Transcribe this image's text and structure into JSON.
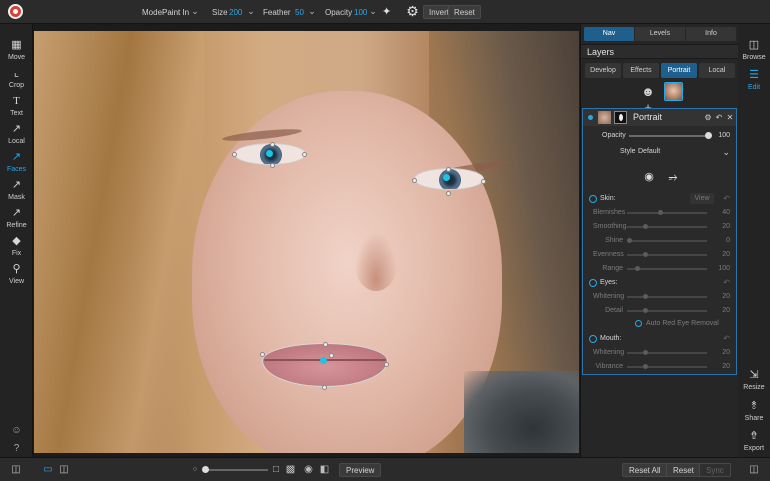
{
  "topbar": {
    "mode_label": "Mode",
    "mode_value": "Paint In",
    "size_label": "Size",
    "size_value": "200",
    "feather_label": "Feather",
    "feather_value": "50",
    "opacity_label": "Opacity",
    "opacity_value": "100",
    "invert_label": "Invert",
    "reset_label": "Reset"
  },
  "leftbar": {
    "tools": [
      {
        "label": "Move",
        "icon": "move-icon"
      },
      {
        "label": "Crop",
        "icon": "crop-icon"
      },
      {
        "label": "Text",
        "icon": "text-icon"
      },
      {
        "label": "Local",
        "icon": "brush-icon"
      },
      {
        "label": "Faces",
        "icon": "faces-brush-icon"
      },
      {
        "label": "Mask",
        "icon": "mask-brush-icon"
      },
      {
        "label": "Refine",
        "icon": "refine-brush-icon"
      },
      {
        "label": "Fix",
        "icon": "eraser-icon"
      },
      {
        "label": "View",
        "icon": "magnifier-icon"
      }
    ],
    "active_tool": "Faces"
  },
  "panel": {
    "top_tabs": [
      "Nav",
      "Levels",
      "Info"
    ],
    "active_top_tab": "Nav",
    "layers_title": "Layers",
    "sub_tabs": [
      "Develop",
      "Effects",
      "Portrait",
      "Local"
    ],
    "active_sub_tab": "Portrait",
    "layer": {
      "name": "Portrait",
      "opacity_label": "Opacity",
      "opacity_value": "100",
      "opacity_level": 1.0,
      "style_label": "Style",
      "style_value": "Default",
      "skin": {
        "title": "Skin:",
        "view_label": "View",
        "sliders": [
          {
            "label": "Blemishes",
            "value": "40",
            "level": 0.4
          },
          {
            "label": "Smoothing",
            "value": "20",
            "level": 0.2
          },
          {
            "label": "Shine",
            "value": "0",
            "level": 0.0
          },
          {
            "label": "Evenness",
            "value": "20",
            "level": 0.2
          },
          {
            "label": "Range",
            "value": "100",
            "level": 0.1
          }
        ]
      },
      "eyes": {
        "title": "Eyes:",
        "sliders": [
          {
            "label": "Whitening",
            "value": "20",
            "level": 0.2
          },
          {
            "label": "Detail",
            "value": "20",
            "level": 0.2
          }
        ],
        "red_eye_label": "Auto Red Eye Removal"
      },
      "mouth": {
        "title": "Mouth:",
        "sliders": [
          {
            "label": "Whitening",
            "value": "20",
            "level": 0.2
          },
          {
            "label": "Vibrance",
            "value": "20",
            "level": 0.2
          }
        ]
      }
    }
  },
  "rightbar": {
    "tools": [
      {
        "label": "Browse",
        "icon": "browse-icon"
      },
      {
        "label": "Edit",
        "icon": "sliders-icon"
      },
      {
        "label": "Resize",
        "icon": "resize-icon"
      },
      {
        "label": "Share",
        "icon": "share-icon"
      },
      {
        "label": "Export",
        "icon": "export-icon"
      }
    ],
    "active_tool": "Edit"
  },
  "bottombar": {
    "preview_label": "Preview",
    "reset_all_label": "Reset All",
    "reset_label": "Reset",
    "sync_label": "Sync",
    "zoom_level": 0.0
  },
  "colors": {
    "accent": "#2aa7e6",
    "tab_active": "#1e5f8e",
    "face_point": "#19c6e8"
  }
}
